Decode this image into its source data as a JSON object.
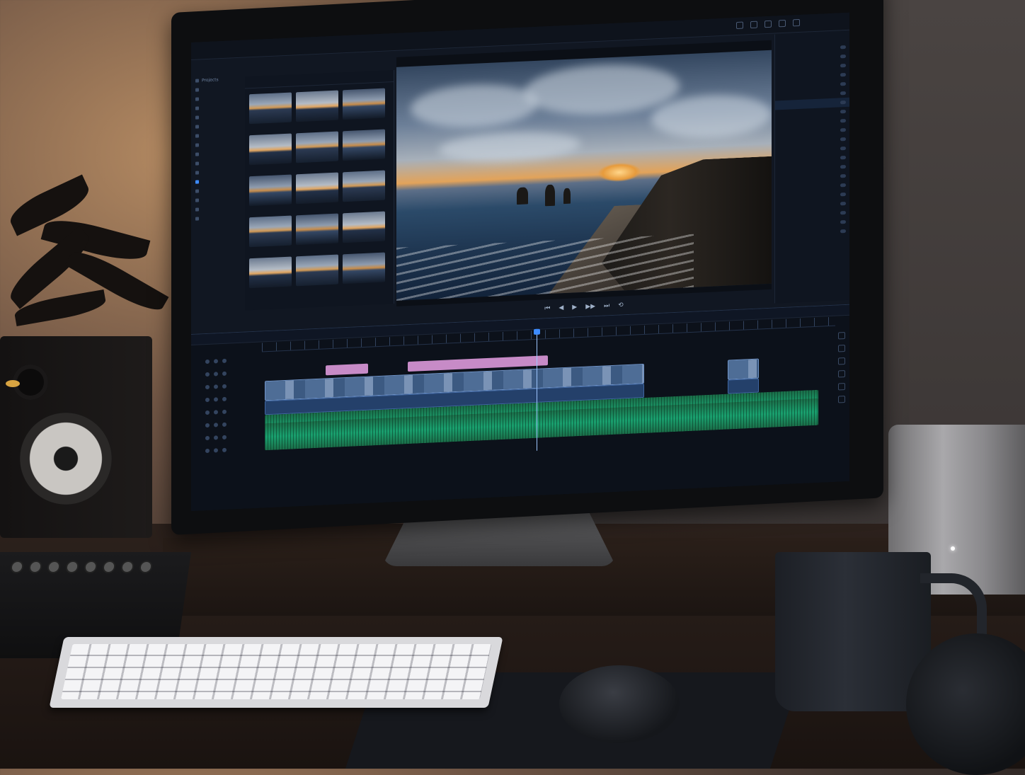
{
  "window": {
    "title": "",
    "top_icons": [
      "fullscreen-icon",
      "undo-icon",
      "redo-icon",
      "share-icon",
      "settings-icon"
    ]
  },
  "sidebar": {
    "items": [
      {
        "label": "Projects",
        "active": false
      },
      {
        "label": "",
        "active": false
      },
      {
        "label": "",
        "active": false
      },
      {
        "label": "",
        "active": false
      },
      {
        "label": "",
        "active": false
      },
      {
        "label": "",
        "active": false
      },
      {
        "label": "",
        "active": false
      },
      {
        "label": "",
        "active": false
      },
      {
        "label": "",
        "active": false
      },
      {
        "label": "",
        "active": false
      },
      {
        "label": "",
        "active": false
      },
      {
        "label": "",
        "active": true
      },
      {
        "label": "",
        "active": false
      },
      {
        "label": "",
        "active": false
      },
      {
        "label": "",
        "active": false
      },
      {
        "label": "",
        "active": false
      }
    ]
  },
  "media": {
    "header": "",
    "thumbs": [
      {
        "caption": "",
        "style": "a"
      },
      {
        "caption": "",
        "style": "b"
      },
      {
        "caption": "",
        "style": "c"
      },
      {
        "caption": "",
        "style": "b"
      },
      {
        "caption": "",
        "style": "a"
      },
      {
        "caption": "",
        "style": "c"
      },
      {
        "caption": "",
        "style": "c"
      },
      {
        "caption": "",
        "style": "b"
      },
      {
        "caption": "",
        "style": "a"
      },
      {
        "caption": "",
        "style": "a"
      },
      {
        "caption": "",
        "style": "c"
      },
      {
        "caption": "",
        "style": "b"
      },
      {
        "caption": "",
        "style": "b"
      },
      {
        "caption": "",
        "style": "a"
      },
      {
        "caption": "",
        "style": "c"
      }
    ]
  },
  "viewer": {
    "header": "",
    "timecode": "",
    "transport": [
      "⏮",
      "◀",
      "▶",
      "▶▶",
      "⏭",
      "⟲"
    ]
  },
  "inspector": {
    "title": "",
    "section": "",
    "rows": [
      {
        "label": "",
        "hl": false
      },
      {
        "label": "",
        "hl": false
      },
      {
        "label": "",
        "hl": false
      },
      {
        "label": "",
        "hl": false
      },
      {
        "label": "",
        "hl": false
      },
      {
        "label": "",
        "hl": false
      },
      {
        "label": "",
        "hl": true
      },
      {
        "label": "",
        "hl": false
      },
      {
        "label": "",
        "hl": false
      },
      {
        "label": "",
        "hl": false
      },
      {
        "label": "",
        "hl": false
      },
      {
        "label": "",
        "hl": false
      },
      {
        "label": "",
        "hl": false
      },
      {
        "label": "",
        "hl": false
      },
      {
        "label": "",
        "hl": false
      },
      {
        "label": "",
        "hl": false
      },
      {
        "label": "",
        "hl": false
      },
      {
        "label": "",
        "hl": false
      },
      {
        "label": "",
        "hl": false
      },
      {
        "label": "",
        "hl": false
      },
      {
        "label": "",
        "hl": false
      }
    ]
  },
  "timeline": {
    "title": ""
  },
  "colors": {
    "accent": "#3d8bff",
    "audio": "#19a06e",
    "title_clip": "#c78bc7",
    "video_clip": "#4e6d96"
  }
}
